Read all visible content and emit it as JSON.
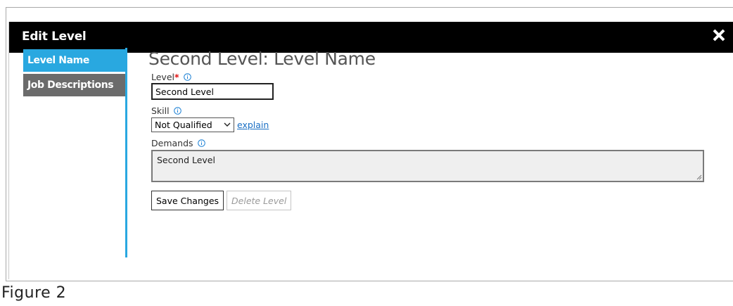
{
  "dialog": {
    "title": "Edit Level",
    "close_icon": "close-icon"
  },
  "sidebar": {
    "items": [
      {
        "label": "Level Name",
        "active": true
      },
      {
        "label": "Job Descriptions",
        "active": false
      }
    ]
  },
  "main": {
    "heading": "Second Level: Level Name",
    "level_field": {
      "label": "Level",
      "required_mark": "*",
      "value": "Second Level"
    },
    "skill_field": {
      "label": "Skill",
      "selected": "Not Qualified",
      "explain_link": "explain"
    },
    "demands_field": {
      "label": "Demands",
      "value": "Second Level"
    },
    "buttons": {
      "save": "Save Changes",
      "delete": "Delete Level"
    }
  },
  "caption": "Figure 2",
  "colors": {
    "titlebar": "#000000",
    "sidebar_active": "#29a8e0",
    "sidebar_inactive": "#6b6b6b",
    "required": "#e01010",
    "link": "#1a6fc4"
  }
}
